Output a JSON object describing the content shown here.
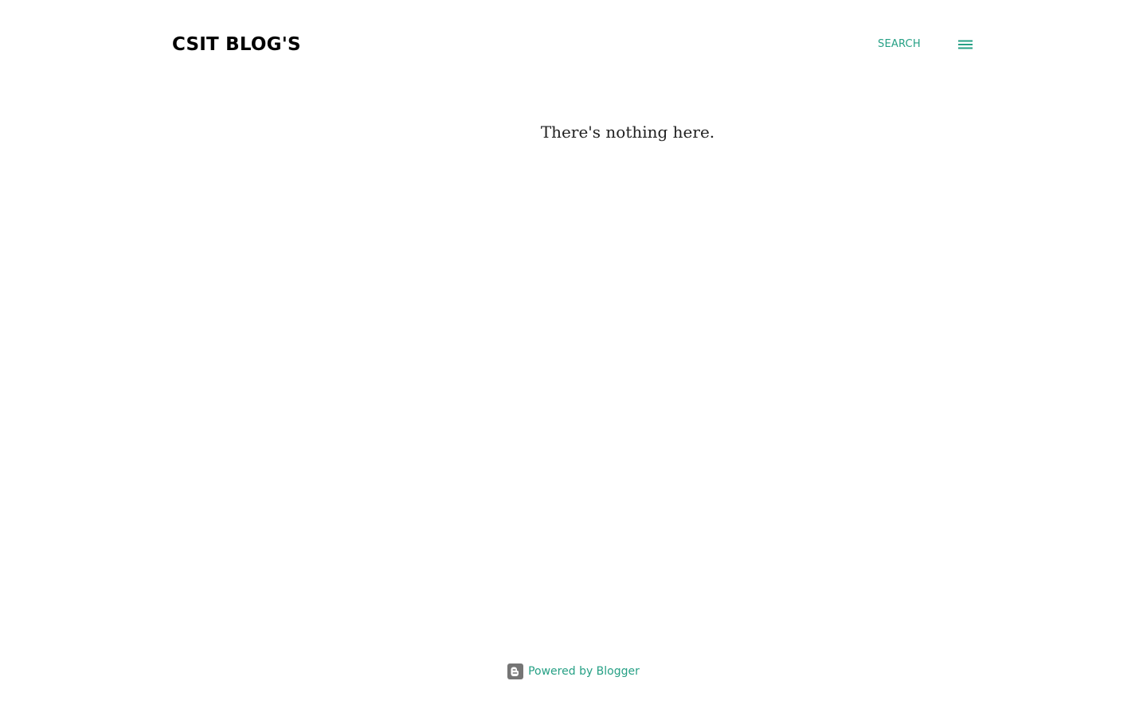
{
  "header": {
    "blog_title": "CSIT BLOG'S",
    "search_label": "Search",
    "menu_icon": "hamburger-menu-icon"
  },
  "main": {
    "empty_message": "There's nothing here."
  },
  "footer": {
    "powered_by_label": "Powered by Blogger",
    "blogger_icon": "blogger-logo-icon"
  },
  "colors": {
    "accent": "#26a085",
    "title": "#000000",
    "body_text": "#212121",
    "icon_gray": "#757575",
    "background": "#ffffff"
  }
}
